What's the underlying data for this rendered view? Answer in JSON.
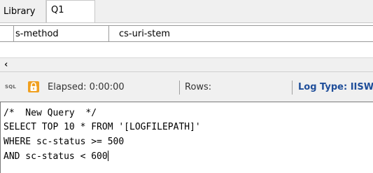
{
  "tabs": [
    {
      "label": "Library"
    },
    {
      "label": "Q1"
    }
  ],
  "grid": {
    "columns": [
      "s-method",
      "cs-uri-stem"
    ]
  },
  "status": {
    "sql_icon": "SQL",
    "elapsed": "Elapsed: 0:00:00",
    "rows": "Rows:",
    "log_type": "Log Type: IISW"
  },
  "editor": {
    "lines": [
      "/*  New Query  */",
      "SELECT TOP 10 * FROM '[LOGFILEPATH]'",
      "WHERE sc-status >= 500",
      "AND sc-status < 600"
    ]
  }
}
